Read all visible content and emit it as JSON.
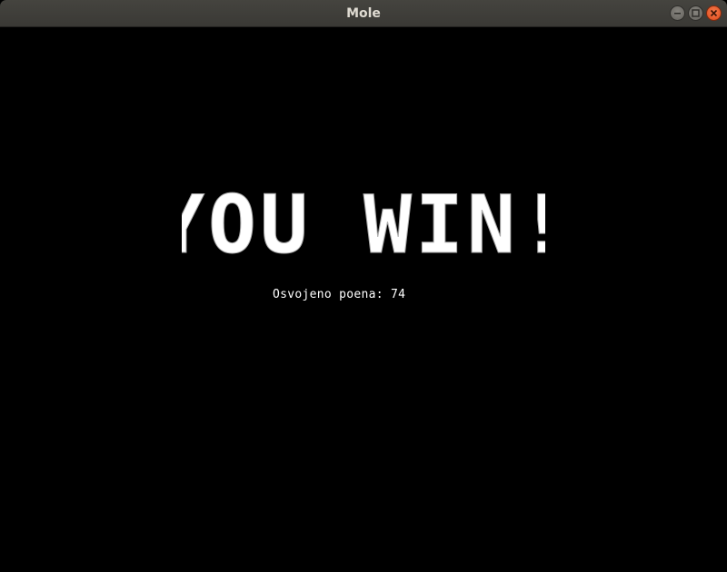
{
  "window": {
    "title": "Mole",
    "controls": [
      "minimize-icon",
      "maximize-icon",
      "close-icon"
    ],
    "close_color": "#e95420"
  },
  "game": {
    "background": "#000000",
    "headline": "YOU WIN!",
    "score_label": "Osvojeno poena:",
    "score_value": "74"
  }
}
